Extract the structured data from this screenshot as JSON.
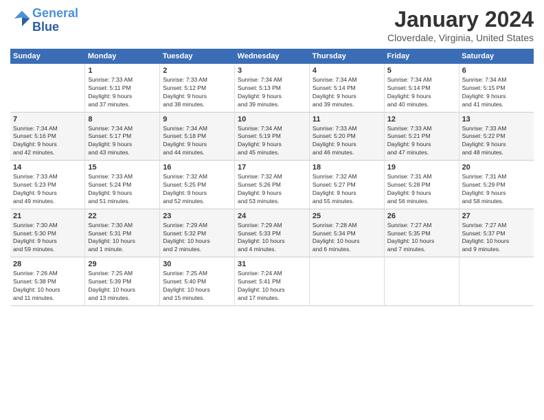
{
  "header": {
    "logo_line1": "General",
    "logo_line2": "Blue",
    "month_year": "January 2024",
    "location": "Cloverdale, Virginia, United States"
  },
  "weekdays": [
    "Sunday",
    "Monday",
    "Tuesday",
    "Wednesday",
    "Thursday",
    "Friday",
    "Saturday"
  ],
  "weeks": [
    [
      {
        "day": "",
        "info": ""
      },
      {
        "day": "1",
        "info": "Sunrise: 7:33 AM\nSunset: 5:11 PM\nDaylight: 9 hours\nand 37 minutes."
      },
      {
        "day": "2",
        "info": "Sunrise: 7:33 AM\nSunset: 5:12 PM\nDaylight: 9 hours\nand 38 minutes."
      },
      {
        "day": "3",
        "info": "Sunrise: 7:34 AM\nSunset: 5:13 PM\nDaylight: 9 hours\nand 39 minutes."
      },
      {
        "day": "4",
        "info": "Sunrise: 7:34 AM\nSunset: 5:14 PM\nDaylight: 9 hours\nand 39 minutes."
      },
      {
        "day": "5",
        "info": "Sunrise: 7:34 AM\nSunset: 5:14 PM\nDaylight: 9 hours\nand 40 minutes."
      },
      {
        "day": "6",
        "info": "Sunrise: 7:34 AM\nSunset: 5:15 PM\nDaylight: 9 hours\nand 41 minutes."
      }
    ],
    [
      {
        "day": "7",
        "info": "Sunrise: 7:34 AM\nSunset: 5:16 PM\nDaylight: 9 hours\nand 42 minutes."
      },
      {
        "day": "8",
        "info": "Sunrise: 7:34 AM\nSunset: 5:17 PM\nDaylight: 9 hours\nand 43 minutes."
      },
      {
        "day": "9",
        "info": "Sunrise: 7:34 AM\nSunset: 5:18 PM\nDaylight: 9 hours\nand 44 minutes."
      },
      {
        "day": "10",
        "info": "Sunrise: 7:34 AM\nSunset: 5:19 PM\nDaylight: 9 hours\nand 45 minutes."
      },
      {
        "day": "11",
        "info": "Sunrise: 7:33 AM\nSunset: 5:20 PM\nDaylight: 9 hours\nand 46 minutes."
      },
      {
        "day": "12",
        "info": "Sunrise: 7:33 AM\nSunset: 5:21 PM\nDaylight: 9 hours\nand 47 minutes."
      },
      {
        "day": "13",
        "info": "Sunrise: 7:33 AM\nSunset: 5:22 PM\nDaylight: 9 hours\nand 48 minutes."
      }
    ],
    [
      {
        "day": "14",
        "info": "Sunrise: 7:33 AM\nSunset: 5:23 PM\nDaylight: 9 hours\nand 49 minutes."
      },
      {
        "day": "15",
        "info": "Sunrise: 7:33 AM\nSunset: 5:24 PM\nDaylight: 9 hours\nand 51 minutes."
      },
      {
        "day": "16",
        "info": "Sunrise: 7:32 AM\nSunset: 5:25 PM\nDaylight: 9 hours\nand 52 minutes."
      },
      {
        "day": "17",
        "info": "Sunrise: 7:32 AM\nSunset: 5:26 PM\nDaylight: 9 hours\nand 53 minutes."
      },
      {
        "day": "18",
        "info": "Sunrise: 7:32 AM\nSunset: 5:27 PM\nDaylight: 9 hours\nand 55 minutes."
      },
      {
        "day": "19",
        "info": "Sunrise: 7:31 AM\nSunset: 5:28 PM\nDaylight: 9 hours\nand 56 minutes."
      },
      {
        "day": "20",
        "info": "Sunrise: 7:31 AM\nSunset: 5:29 PM\nDaylight: 9 hours\nand 58 minutes."
      }
    ],
    [
      {
        "day": "21",
        "info": "Sunrise: 7:30 AM\nSunset: 5:30 PM\nDaylight: 9 hours\nand 59 minutes."
      },
      {
        "day": "22",
        "info": "Sunrise: 7:30 AM\nSunset: 5:31 PM\nDaylight: 10 hours\nand 1 minute."
      },
      {
        "day": "23",
        "info": "Sunrise: 7:29 AM\nSunset: 5:32 PM\nDaylight: 10 hours\nand 2 minutes."
      },
      {
        "day": "24",
        "info": "Sunrise: 7:29 AM\nSunset: 5:33 PM\nDaylight: 10 hours\nand 4 minutes."
      },
      {
        "day": "25",
        "info": "Sunrise: 7:28 AM\nSunset: 5:34 PM\nDaylight: 10 hours\nand 6 minutes."
      },
      {
        "day": "26",
        "info": "Sunrise: 7:27 AM\nSunset: 5:35 PM\nDaylight: 10 hours\nand 7 minutes."
      },
      {
        "day": "27",
        "info": "Sunrise: 7:27 AM\nSunset: 5:37 PM\nDaylight: 10 hours\nand 9 minutes."
      }
    ],
    [
      {
        "day": "28",
        "info": "Sunrise: 7:26 AM\nSunset: 5:38 PM\nDaylight: 10 hours\nand 11 minutes."
      },
      {
        "day": "29",
        "info": "Sunrise: 7:25 AM\nSunset: 5:39 PM\nDaylight: 10 hours\nand 13 minutes."
      },
      {
        "day": "30",
        "info": "Sunrise: 7:25 AM\nSunset: 5:40 PM\nDaylight: 10 hours\nand 15 minutes."
      },
      {
        "day": "31",
        "info": "Sunrise: 7:24 AM\nSunset: 5:41 PM\nDaylight: 10 hours\nand 17 minutes."
      },
      {
        "day": "",
        "info": ""
      },
      {
        "day": "",
        "info": ""
      },
      {
        "day": "",
        "info": ""
      }
    ]
  ]
}
